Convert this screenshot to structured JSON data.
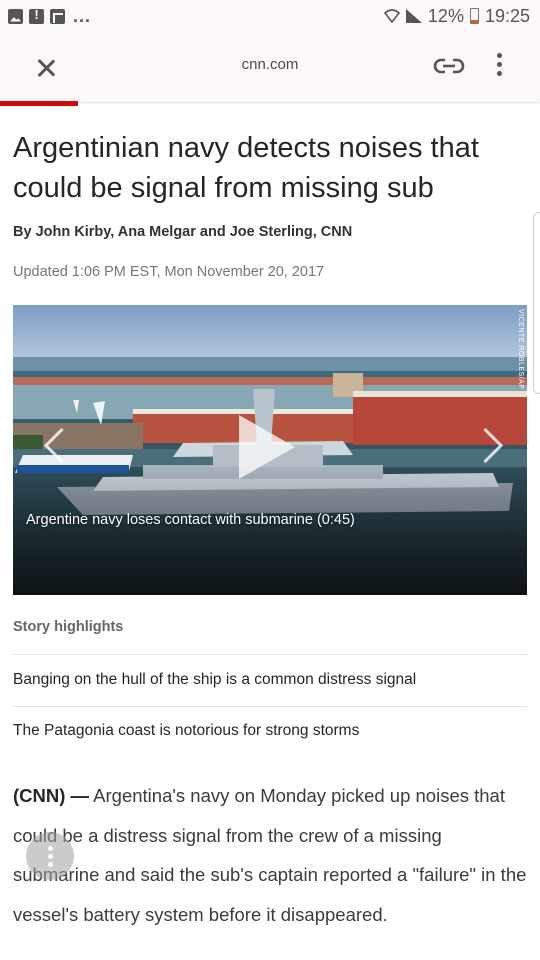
{
  "status_bar": {
    "battery": "12%",
    "time": "19:25",
    "overflow": "..."
  },
  "toolbar": {
    "url": "cnn.com"
  },
  "article": {
    "headline": "Argentinian navy detects noises that could be signal from missing sub",
    "byline": "By John Kirby, Ana Melgar and Joe Sterling, CNN",
    "updated": "Updated 1:06 PM EST, Mon November 20, 2017",
    "video": {
      "caption": "Argentine navy loses contact with submarine (0:45)",
      "watermark": "VICENTE ROBLES/AP"
    },
    "highlights": {
      "title": "Story highlights",
      "items": [
        "Banging on the hull of the ship is a common distress signal",
        "The Patagonia coast is notorious for strong storms"
      ]
    },
    "body": {
      "source": "(CNN) —",
      "text": " Argentina's navy on Monday picked up noises that could be a distress signal from the crew of a missing submarine and said the sub's captain reported a \"failure\" in the vessel's battery system before it disappeared."
    }
  },
  "colors": {
    "progress": "#d40b0b",
    "toolbar_bg": "#fbf7fb"
  }
}
